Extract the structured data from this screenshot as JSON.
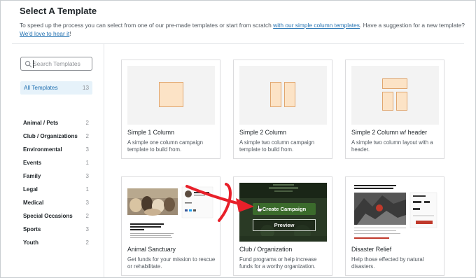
{
  "header": {
    "title": "Select A Template",
    "description_prefix": "To speed up the process you can select from one of our pre-made templates or start from scratch ",
    "description_link1": "with our simple column templates",
    "description_middle": ". Have a suggestion for a new template? ",
    "description_link2": "We'd love to hear it",
    "description_suffix": "!"
  },
  "sidebar": {
    "search_placeholder": "Search Templates",
    "all": {
      "label": "All Templates",
      "count": "13"
    },
    "categories": [
      {
        "label": "Animal / Pets",
        "count": "2"
      },
      {
        "label": "Club / Organizations",
        "count": "2"
      },
      {
        "label": "Environmental",
        "count": "3"
      },
      {
        "label": "Events",
        "count": "1"
      },
      {
        "label": "Family",
        "count": "3"
      },
      {
        "label": "Legal",
        "count": "1"
      },
      {
        "label": "Medical",
        "count": "3"
      },
      {
        "label": "Special Occasions",
        "count": "2"
      },
      {
        "label": "Sports",
        "count": "3"
      },
      {
        "label": "Youth",
        "count": "2"
      }
    ]
  },
  "templates": [
    {
      "name": "Simple 1 Column",
      "description": "A simple one column campaign template to build from."
    },
    {
      "name": "Simple 2 Column",
      "description": "A simple two column campaign template to build from."
    },
    {
      "name": "Simple 2 Column w/ header",
      "description": "A simple two column layout with a header."
    },
    {
      "name": "Animal Sanctuary",
      "description": "Get funds for your mission to rescue or rehabilitate.",
      "preview_text": "Donate today to support our mission to rescue, rehabilitate and rehome"
    },
    {
      "name": "Club / Organization",
      "description": "Fund programs or help increase funds for a worthy organization."
    },
    {
      "name": "Disaster Relief",
      "description": "Help those effected by natural disasters.",
      "preview_title": "Help those affected by the earthquake in Turkey and Syria"
    }
  ],
  "hover": {
    "create_label": "Create Campaign",
    "preview_label": "Preview"
  },
  "colors": {
    "accent": "#2271b1",
    "column_fill": "#fce3c6",
    "column_stroke": "#e0a66e",
    "arrow": "#e8202a",
    "cta_green": "#3b6b2c"
  }
}
